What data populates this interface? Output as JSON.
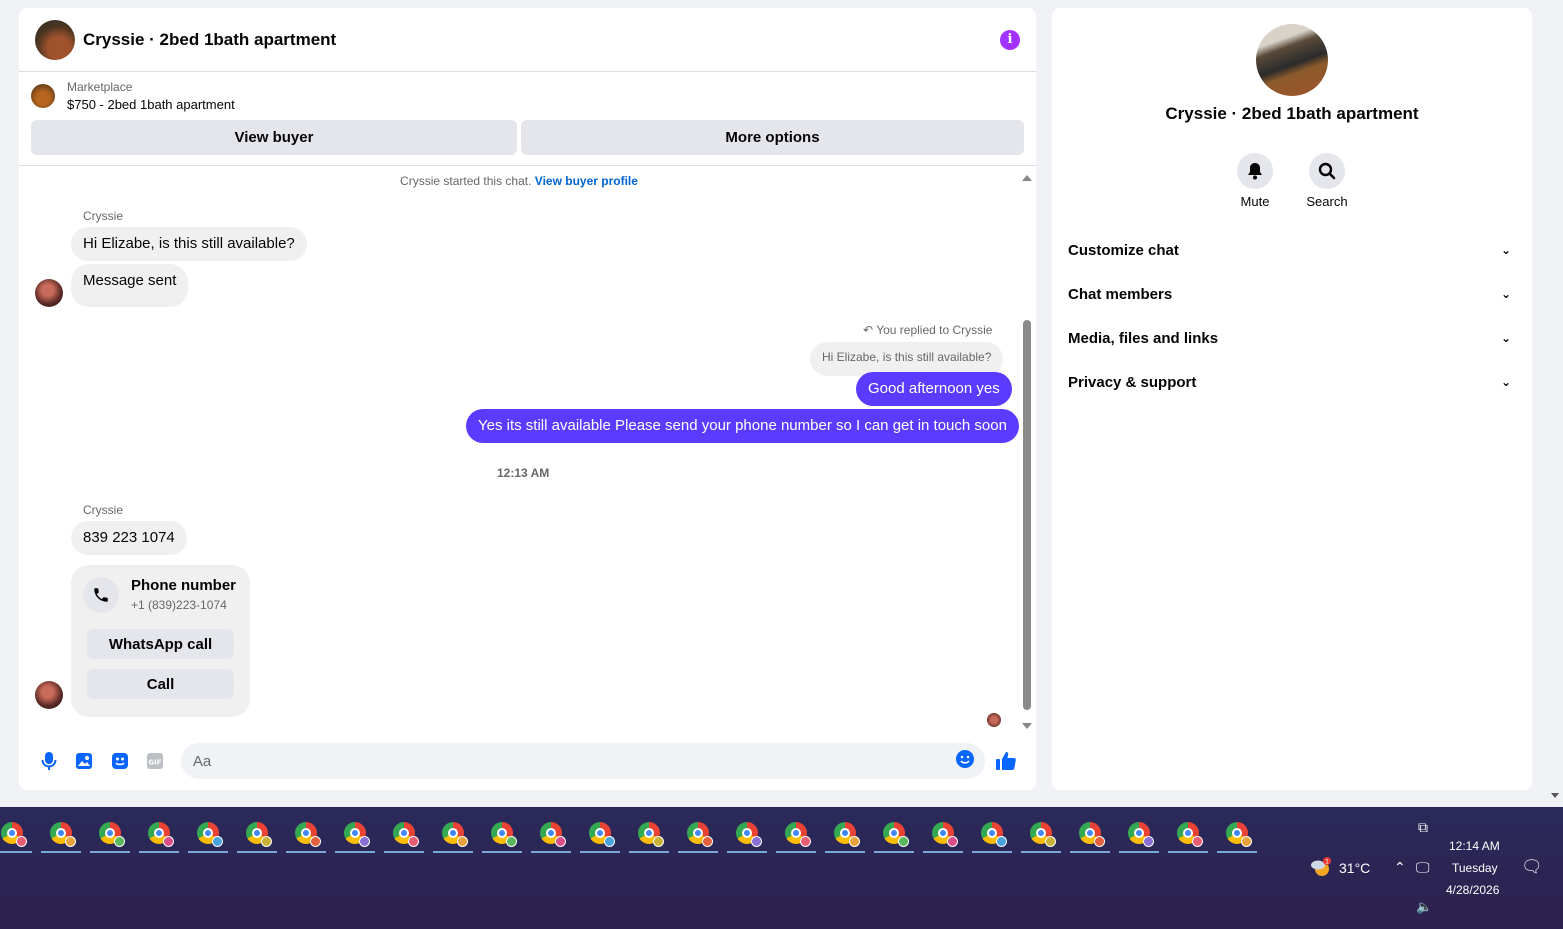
{
  "chat": {
    "title": "Cryssie · 2bed 1bath apartment",
    "marketplace_label": "Marketplace",
    "listing": "$750 - 2bed 1bath apartment",
    "view_buyer": "View buyer",
    "more_options": "More options",
    "started_text": "Cryssie started this chat.",
    "view_buyer_profile": "View buyer profile",
    "sender1": "Cryssie",
    "msg1": "Hi Elizabe, is this still available?",
    "msg2": "Message sent",
    "reply_note": "You replied to Cryssie",
    "quoted": "Hi Elizabe, is this still available?",
    "out1": "Good afternoon yes",
    "out2": "Yes its still available Please send your phone number so I can get in touch soon",
    "timestamp": "12:13 AM",
    "sender2": "Cryssie",
    "msg3": "839 223 1074",
    "phone_label": "Phone number",
    "phone_num": "+1 (839)223-1074",
    "whatsapp_call": "WhatsApp call",
    "call": "Call",
    "input_placeholder": "Aa"
  },
  "info": {
    "title": "Cryssie · 2bed 1bath apartment",
    "mute": "Mute",
    "search": "Search",
    "sections": [
      "Customize chat",
      "Chat members",
      "Media, files and links",
      "Privacy & support"
    ]
  },
  "taskbar": {
    "app_count": 26,
    "temperature": "31°C",
    "weather_badge": "1",
    "time": "12:14 AM",
    "day": "Tuesday",
    "date": "4/28/2026"
  },
  "colors": {
    "accent": "#5b3bff",
    "info": "#a033ff",
    "link": "#0064d1"
  }
}
